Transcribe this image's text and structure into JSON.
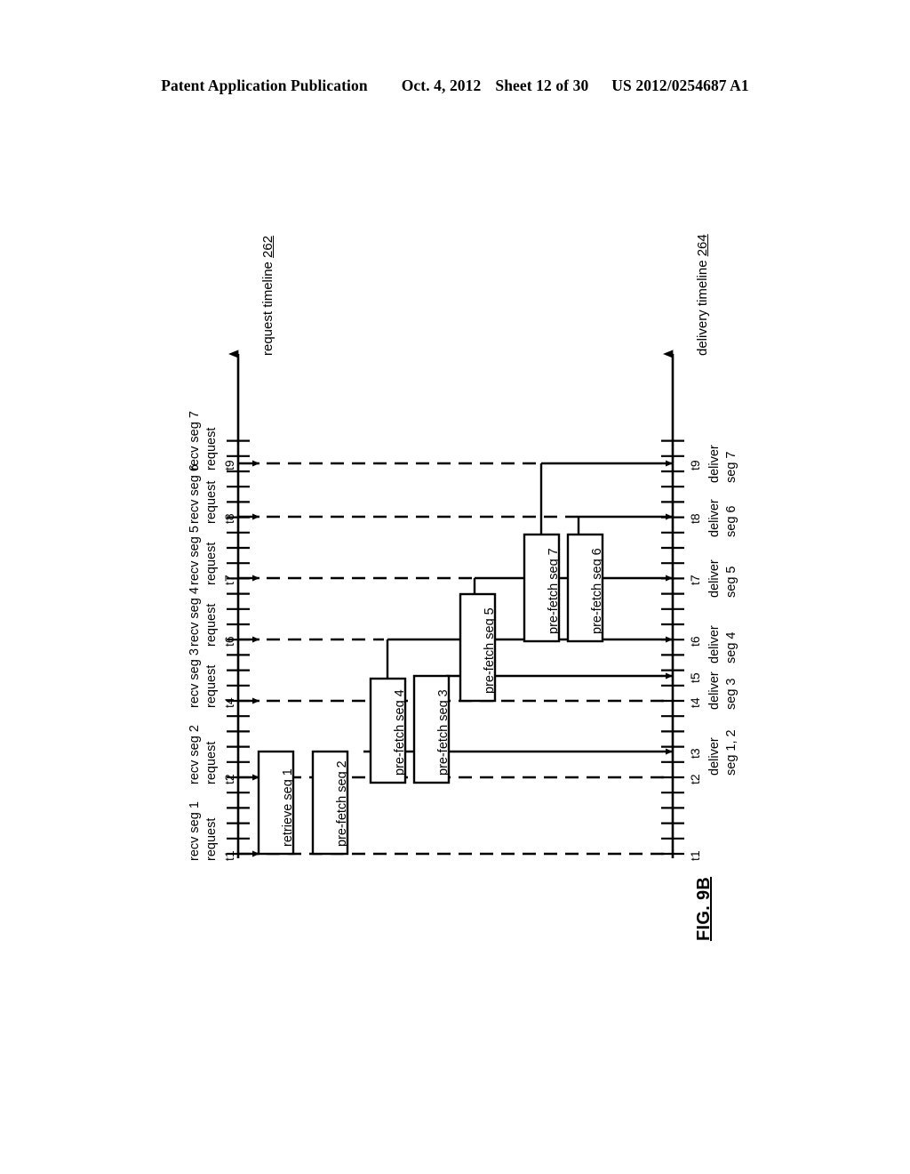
{
  "header": {
    "publication": "Patent Application Publication",
    "date": "Oct. 4, 2012",
    "sheet": "Sheet 12 of 30",
    "patent_number": "US 2012/0254687 A1"
  },
  "figure": {
    "label": "FIG. 9B",
    "request_timeline": {
      "name": "request timeline",
      "reference_numeral": "262"
    },
    "delivery_timeline": {
      "name": "delivery timeline",
      "reference_numeral": "264"
    },
    "request_events": [
      {
        "tick": "t1",
        "line1": "recv seg 1",
        "line2": "request"
      },
      {
        "tick": "t2",
        "line1": "recv seg 2",
        "line2": "request"
      },
      {
        "tick": "t4",
        "line1": "recv seg 3",
        "line2": "request"
      },
      {
        "tick": "t6",
        "line1": "recv seg 4",
        "line2": "request"
      },
      {
        "tick": "t7",
        "line1": "recv seg 5",
        "line2": "request"
      },
      {
        "tick": "t8",
        "line1": "recv seg 6",
        "line2": "request"
      },
      {
        "tick": "t9",
        "line1": "recv seg 7",
        "line2": "request"
      }
    ],
    "delivery_events": [
      {
        "tick": "t1"
      },
      {
        "tick": "t2"
      },
      {
        "tick": "t3",
        "line1": "deliver",
        "line2": "seg 1, 2"
      },
      {
        "tick": "t4",
        "line1": "deliver",
        "line2": "seg 3"
      },
      {
        "tick": "t5",
        "line1": "deliver",
        "line2": "seg 4"
      },
      {
        "tick": "t6"
      },
      {
        "tick": "t7",
        "line1": "deliver",
        "line2": "seg 5"
      },
      {
        "tick": "t8",
        "line1": "deliver",
        "line2": "seg 6"
      },
      {
        "tick": "t9",
        "line1": "deliver",
        "line2": "seg 7"
      }
    ],
    "process_boxes": [
      {
        "id": "box-retrieve-seg-1",
        "label": "retrieve seg 1"
      },
      {
        "id": "box-prefetch-seg-2",
        "label": "pre-fetch seg 2"
      },
      {
        "id": "box-prefetch-seg-4",
        "label": "pre-fetch seg 4"
      },
      {
        "id": "box-prefetch-seg-3",
        "label": "pre-fetch seg 3"
      },
      {
        "id": "box-prefetch-seg-5",
        "label": "pre-fetch seg 5"
      },
      {
        "id": "box-prefetch-seg-7",
        "label": "pre-fetch seg 7"
      },
      {
        "id": "box-prefetch-seg-6",
        "label": "pre-fetch seg 6"
      }
    ]
  }
}
